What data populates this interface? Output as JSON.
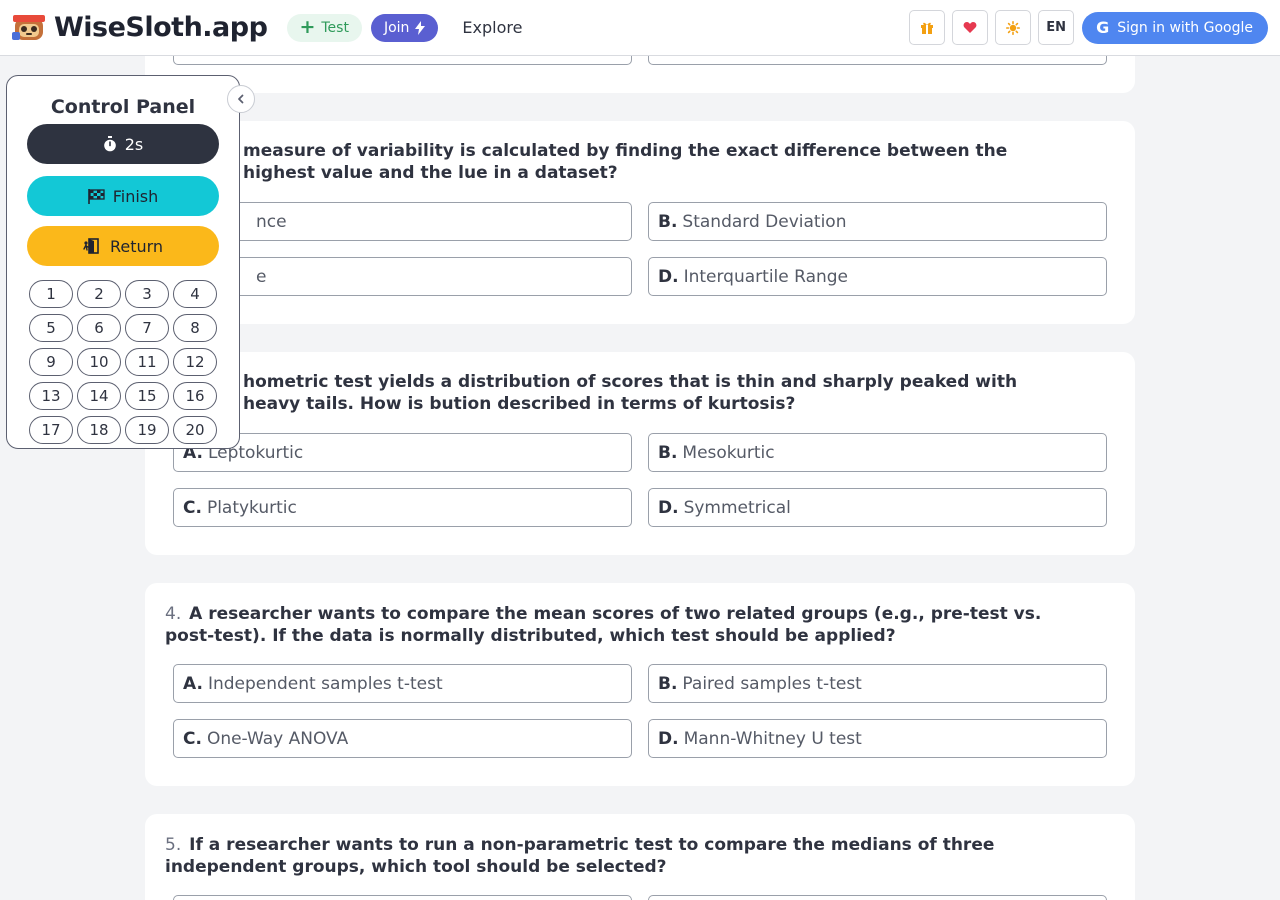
{
  "header": {
    "brand": "WiseSloth.app",
    "test_label": "Test",
    "join_label": "Join",
    "explore_label": "Explore",
    "lang_label": "EN",
    "google_label": "Sign in with Google",
    "accent_blue": "#4f86f0",
    "join_color": "#5a5fd1"
  },
  "panel": {
    "title": "Control Panel",
    "timer_label": "2s",
    "finish_label": "Finish",
    "return_label": "Return",
    "numbers": [
      "1",
      "2",
      "3",
      "4",
      "5",
      "6",
      "7",
      "8",
      "9",
      "10",
      "11",
      "12",
      "13",
      "14",
      "15",
      "16",
      "17",
      "18",
      "19",
      "20"
    ]
  },
  "questions": [
    {
      "options": [
        {
          "letter": "",
          "text": ""
        },
        {
          "letter": "",
          "text": ""
        }
      ]
    },
    {
      "number": "",
      "text": "measure of variability is calculated by finding the exact difference between the highest value and the lue in a dataset?",
      "options": [
        {
          "letter": "",
          "text": "nce"
        },
        {
          "letter": "B.",
          "text": "Standard Deviation"
        },
        {
          "letter": "",
          "text": "e"
        },
        {
          "letter": "D.",
          "text": "Interquartile Range"
        }
      ]
    },
    {
      "number": "",
      "text": "hometric test yields a distribution of scores that is thin and sharply peaked with heavy tails. How is bution described in terms of kurtosis?",
      "options": [
        {
          "letter": "A.",
          "text": "Leptokurtic"
        },
        {
          "letter": "B.",
          "text": "Mesokurtic"
        },
        {
          "letter": "C.",
          "text": "Platykurtic"
        },
        {
          "letter": "D.",
          "text": "Symmetrical"
        }
      ]
    },
    {
      "number": "4.",
      "text": "A researcher wants to compare the mean scores of two related groups (e.g., pre-test vs. post-test). If the data is normally distributed, which test should be applied?",
      "options": [
        {
          "letter": "A.",
          "text": "Independent samples t-test"
        },
        {
          "letter": "B.",
          "text": "Paired samples t-test"
        },
        {
          "letter": "C.",
          "text": "One-Way ANOVA"
        },
        {
          "letter": "D.",
          "text": "Mann-Whitney U test"
        }
      ]
    },
    {
      "number": "5.",
      "text": "If a researcher wants to run a non-parametric test to compare the medians of three independent groups, which tool should be selected?",
      "options": [
        {
          "letter": "",
          "text": ""
        },
        {
          "letter": "",
          "text": ""
        }
      ]
    }
  ]
}
